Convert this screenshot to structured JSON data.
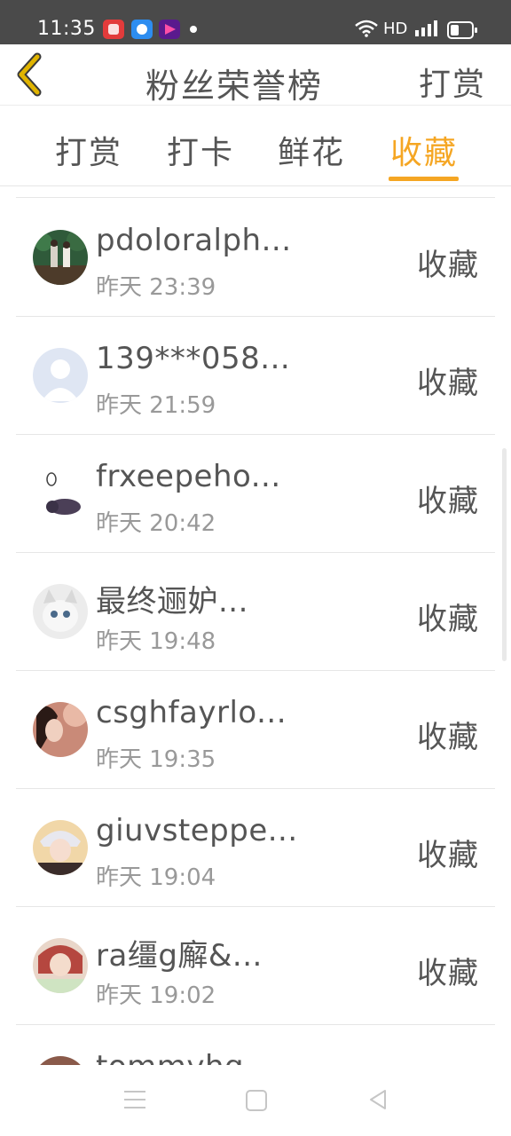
{
  "status_bar": {
    "time": "11:35",
    "network_label": "HD",
    "icons": [
      "app-red-icon",
      "app-blue-icon",
      "app-purple-icon",
      "wifi-icon",
      "signal-icon",
      "battery-icon"
    ]
  },
  "header": {
    "title": "粉丝荣誉榜",
    "right_action": "打赏",
    "back_icon": "back-chevron-icon"
  },
  "tabs": [
    {
      "label": "打赏",
      "active": false
    },
    {
      "label": "打卡",
      "active": false
    },
    {
      "label": "鲜花",
      "active": false
    },
    {
      "label": "收藏",
      "active": true
    }
  ],
  "list": {
    "items": [
      {
        "name": "pdoloralph...",
        "time": "昨天 23:39",
        "action": "收藏"
      },
      {
        "name": "139***058...",
        "time": "昨天 21:59",
        "action": "收藏"
      },
      {
        "name": "frxeepeho...",
        "time": "昨天 20:42",
        "action": "收藏"
      },
      {
        "name": "最终逦妒...",
        "time": "昨天 19:48",
        "action": "收藏"
      },
      {
        "name": "csghfayrlo...",
        "time": "昨天 19:35",
        "action": "收藏"
      },
      {
        "name": "giuvsteppe...",
        "time": "昨天 19:04",
        "action": "收藏"
      },
      {
        "name": "ra缰g廨&...",
        "time": "昨天 19:02",
        "action": "收藏"
      },
      {
        "name": "tommyhg",
        "time": "",
        "action": ""
      }
    ]
  },
  "colors": {
    "accent": "#f5a623",
    "status_bar": "#4a4a4a",
    "text": "#555555",
    "subtext": "#999999"
  },
  "nav_bar": {
    "icons": [
      "menu-icon",
      "home-icon",
      "back-triangle-icon"
    ]
  }
}
